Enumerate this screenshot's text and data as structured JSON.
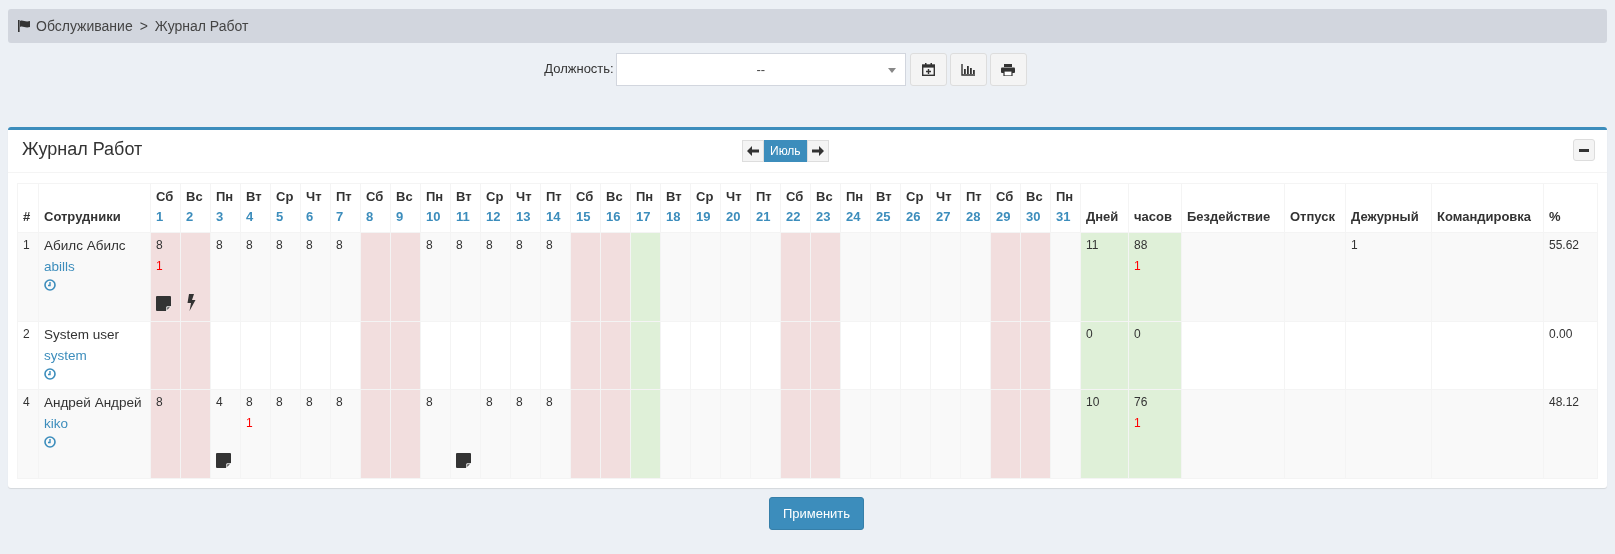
{
  "breadcrumb": {
    "items": [
      "Обслуживание",
      "Журнал Работ"
    ],
    "separator": ">"
  },
  "toolbar": {
    "label": "Должность:",
    "select": {
      "value": "--"
    },
    "buttons": [
      {
        "kind": "calendar"
      },
      {
        "kind": "chart"
      },
      {
        "kind": "print"
      }
    ]
  },
  "journal": {
    "title": "Журнал Работ",
    "month": "Июль",
    "columns": {
      "number": "#",
      "employee": "Сотрудники"
    },
    "days": [
      {
        "weekday": "Сб",
        "day": "1",
        "kind": "weekend"
      },
      {
        "weekday": "Вс",
        "day": "2",
        "kind": "weekend"
      },
      {
        "weekday": "Пн",
        "day": "3",
        "kind": "workday"
      },
      {
        "weekday": "Вт",
        "day": "4",
        "kind": "workday"
      },
      {
        "weekday": "Ср",
        "day": "5",
        "kind": "workday"
      },
      {
        "weekday": "Чт",
        "day": "6",
        "kind": "workday"
      },
      {
        "weekday": "Пт",
        "day": "7",
        "kind": "workday"
      },
      {
        "weekday": "Сб",
        "day": "8",
        "kind": "weekend"
      },
      {
        "weekday": "Вс",
        "day": "9",
        "kind": "weekend"
      },
      {
        "weekday": "Пн",
        "day": "10",
        "kind": "workday"
      },
      {
        "weekday": "Вт",
        "day": "11",
        "kind": "workday"
      },
      {
        "weekday": "Ср",
        "day": "12",
        "kind": "workday"
      },
      {
        "weekday": "Чт",
        "day": "13",
        "kind": "workday"
      },
      {
        "weekday": "Пт",
        "day": "14",
        "kind": "workday"
      },
      {
        "weekday": "Сб",
        "day": "15",
        "kind": "weekend"
      },
      {
        "weekday": "Вс",
        "day": "16",
        "kind": "weekend"
      },
      {
        "weekday": "Пн",
        "day": "17",
        "kind": "holiday"
      },
      {
        "weekday": "Вт",
        "day": "18",
        "kind": "workday"
      },
      {
        "weekday": "Ср",
        "day": "19",
        "kind": "workday"
      },
      {
        "weekday": "Чт",
        "day": "20",
        "kind": "workday"
      },
      {
        "weekday": "Пт",
        "day": "21",
        "kind": "workday"
      },
      {
        "weekday": "Сб",
        "day": "22",
        "kind": "weekend"
      },
      {
        "weekday": "Вс",
        "day": "23",
        "kind": "weekend"
      },
      {
        "weekday": "Пн",
        "day": "24",
        "kind": "workday"
      },
      {
        "weekday": "Вт",
        "day": "25",
        "kind": "workday"
      },
      {
        "weekday": "Ср",
        "day": "26",
        "kind": "workday"
      },
      {
        "weekday": "Чт",
        "day": "27",
        "kind": "workday"
      },
      {
        "weekday": "Пт",
        "day": "28",
        "kind": "workday"
      },
      {
        "weekday": "Сб",
        "day": "29",
        "kind": "weekend"
      },
      {
        "weekday": "Вс",
        "day": "30",
        "kind": "weekend"
      },
      {
        "weekday": "Пн",
        "day": "31",
        "kind": "workday"
      }
    ],
    "summary_columns": [
      {
        "label": "Дней",
        "kind": "total"
      },
      {
        "label": "часов",
        "kind": "total"
      },
      {
        "label": "Бездействие",
        "kind": "plain"
      },
      {
        "label": "Отпуск",
        "kind": "plain"
      },
      {
        "label": "Дежурный",
        "kind": "plain"
      },
      {
        "label": "Командировка",
        "kind": "plain"
      },
      {
        "label": "%",
        "kind": "plain"
      }
    ],
    "rows": [
      {
        "number": "1",
        "name": "Абилс Абилс",
        "login": "abills",
        "cells": [
          {
            "hours": "8",
            "extra": "1",
            "icons": [
              {
                "kind": "note"
              }
            ]
          },
          {
            "icons": [
              {
                "kind": "bolt"
              }
            ]
          },
          {
            "hours": "8"
          },
          {
            "hours": "8"
          },
          {
            "hours": "8"
          },
          {
            "hours": "8"
          },
          {
            "hours": "8"
          },
          {},
          {},
          {
            "hours": "8"
          },
          {
            "hours": "8"
          },
          {
            "hours": "8"
          },
          {
            "hours": "8"
          },
          {
            "hours": "8"
          },
          {},
          {},
          {},
          {},
          {},
          {},
          {},
          {},
          {},
          {},
          {},
          {},
          {},
          {},
          {},
          {},
          {}
        ],
        "summary": {
          "days": "11",
          "hours": "88",
          "hours_extra": "1",
          "duty": "1",
          "percent": "55.62"
        }
      },
      {
        "number": "2",
        "name": "System user",
        "login": "system",
        "cells": [
          {},
          {},
          {},
          {},
          {},
          {},
          {},
          {},
          {},
          {},
          {},
          {},
          {},
          {},
          {},
          {},
          {},
          {},
          {},
          {},
          {},
          {},
          {},
          {},
          {},
          {},
          {},
          {},
          {},
          {},
          {}
        ],
        "summary": {
          "days": "0",
          "hours": "0",
          "percent": "0.00"
        }
      },
      {
        "number": "4",
        "name": "Андрей Андрей",
        "login": "kiko",
        "cells": [
          {
            "hours": "8"
          },
          {},
          {
            "hours": "4",
            "icons": [
              {
                "kind": "note"
              }
            ]
          },
          {
            "hours": "8",
            "extra": "1"
          },
          {
            "hours": "8"
          },
          {
            "hours": "8"
          },
          {
            "hours": "8"
          },
          {},
          {},
          {
            "hours": "8"
          },
          {
            "icons": [
              {
                "kind": "note"
              }
            ]
          },
          {
            "hours": "8"
          },
          {
            "hours": "8"
          },
          {
            "hours": "8"
          },
          {},
          {},
          {},
          {},
          {},
          {},
          {},
          {},
          {},
          {},
          {},
          {},
          {},
          {},
          {},
          {},
          {}
        ],
        "summary": {
          "days": "10",
          "hours": "76",
          "hours_extra": "1",
          "percent": "48.12"
        }
      }
    ]
  },
  "apply_button": "Применить"
}
